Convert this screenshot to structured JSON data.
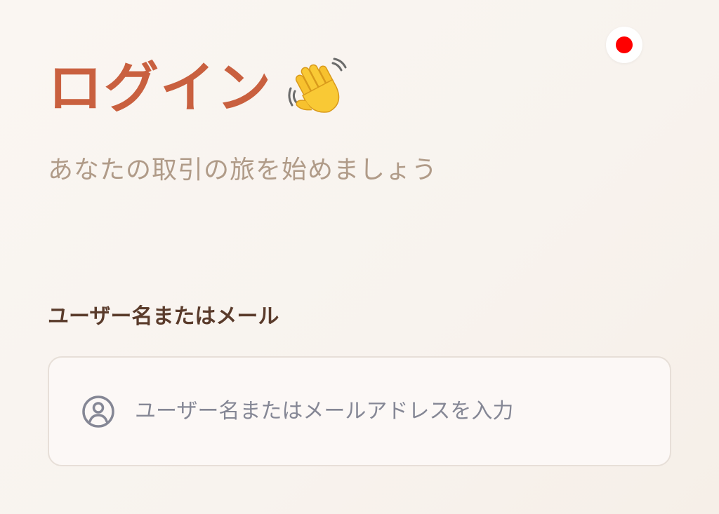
{
  "header": {
    "language_icon": "japan-flag-icon",
    "language_dot_color": "#ff0000"
  },
  "login": {
    "title": "ログイン",
    "title_emoji_icon": "waving-hand-icon",
    "subtitle": "あなたの取引の旅を始めましょう"
  },
  "form": {
    "username_label": "ユーザー名またはメール",
    "username_value": "",
    "username_placeholder": "ユーザー名またはメールアドレスを入力",
    "username_icon": "user-circle-icon"
  },
  "colors": {
    "title": "#c9603f",
    "subtitle": "#b09b88",
    "label": "#5a3b2b",
    "input_border": "#e7dfd8",
    "icon": "#858795"
  }
}
